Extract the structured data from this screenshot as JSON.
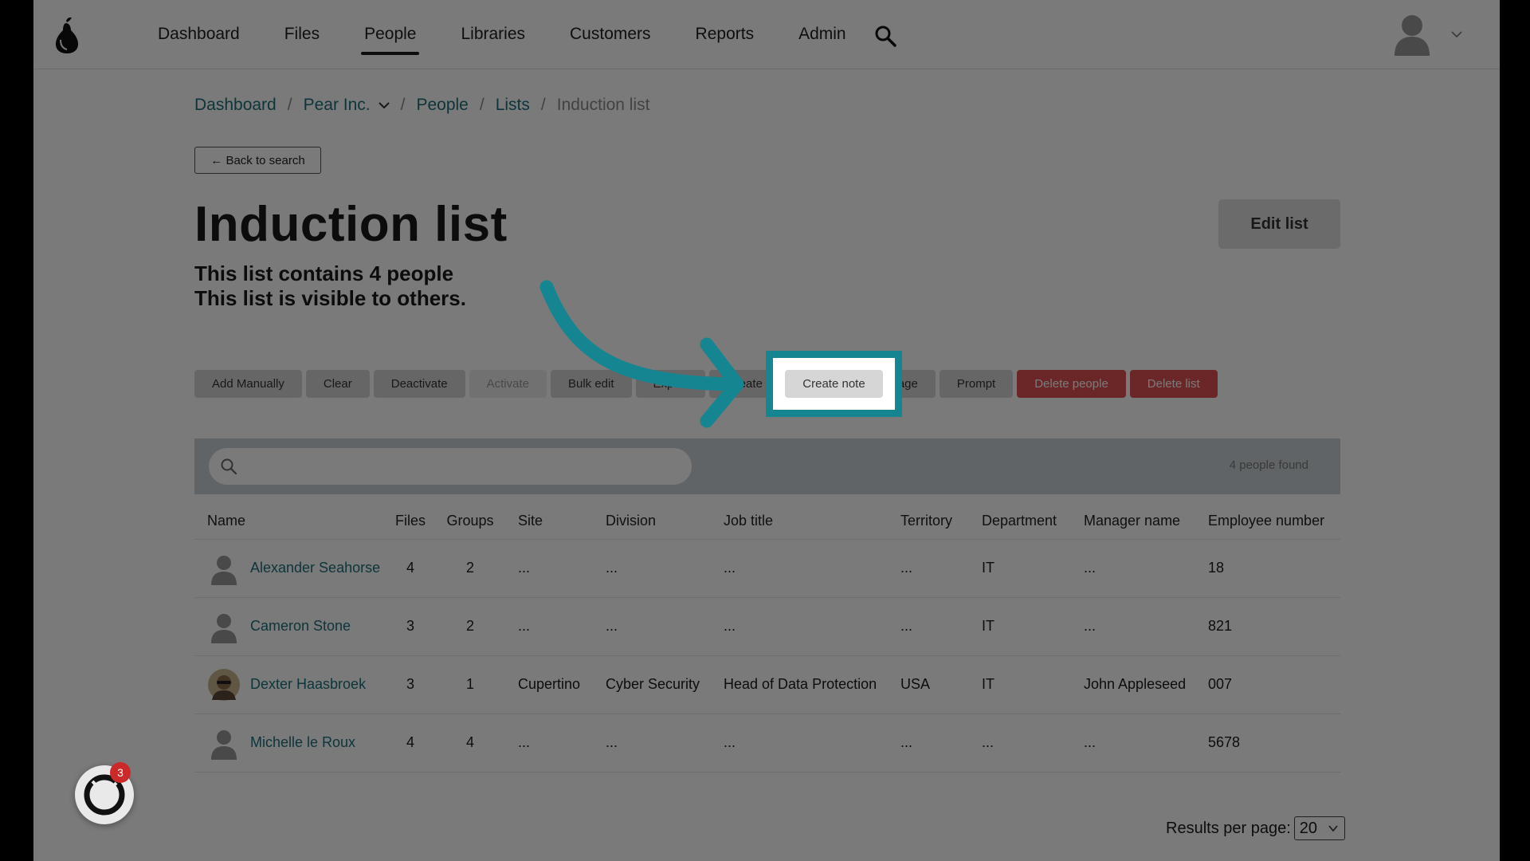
{
  "nav": {
    "items": [
      {
        "label": "Dashboard"
      },
      {
        "label": "Files"
      },
      {
        "label": "People",
        "active": true
      },
      {
        "label": "Libraries"
      },
      {
        "label": "Customers"
      },
      {
        "label": "Reports"
      },
      {
        "label": "Admin"
      }
    ],
    "search_icon": "search-icon",
    "avatar_icon": "user-avatar-icon"
  },
  "breadcrumb": {
    "items": [
      "Dashboard",
      "Pear Inc.",
      "People",
      "Lists",
      "Induction list"
    ],
    "separator": "/"
  },
  "back_button": "← Back to search",
  "page": {
    "title": "Induction list",
    "edit_label": "Edit list",
    "summary_line1": "This list contains 4 people",
    "summary_line2": "This list is visible to others."
  },
  "actions": {
    "add_manually": "Add Manually",
    "clear": "Clear",
    "deactivate": "Deactivate",
    "activate": "Activate",
    "bulk_edit": "Bulk edit",
    "export": "Export",
    "create_note": "Create note",
    "send_message": "Send a message",
    "prompt": "Prompt",
    "delete_people": "Delete people",
    "delete_list": "Delete list"
  },
  "search": {
    "placeholder": "",
    "found_text": "4 people found"
  },
  "table": {
    "headers": [
      "Name",
      "Files",
      "Groups",
      "Site",
      "Division",
      "Job title",
      "Territory",
      "Department",
      "Manager name",
      "Employee number"
    ],
    "rows": [
      {
        "name": "Alexander Seahorse",
        "files": "4",
        "groups": "2",
        "site": "...",
        "division": "...",
        "job_title": "...",
        "territory": "...",
        "department": "IT",
        "manager": "...",
        "employee_number": "18"
      },
      {
        "name": "Cameron Stone",
        "files": "3",
        "groups": "2",
        "site": "...",
        "division": "...",
        "job_title": "...",
        "territory": "...",
        "department": "IT",
        "manager": "...",
        "employee_number": "821"
      },
      {
        "name": "Dexter Haasbroek",
        "files": "3",
        "groups": "1",
        "site": "Cupertino",
        "division": "Cyber Security",
        "job_title": "Head of Data Protection",
        "territory": "USA",
        "department": "IT",
        "manager": "John Appleseed",
        "employee_number": "007"
      },
      {
        "name": "Michelle le Roux",
        "files": "4",
        "groups": "4",
        "site": "...",
        "division": "...",
        "job_title": "...",
        "territory": "...",
        "department": "...",
        "manager": "...",
        "employee_number": "5678"
      }
    ]
  },
  "pagination": {
    "label": "Results per page:",
    "value": "20"
  },
  "widget": {
    "badge": "3"
  },
  "colors": {
    "accent": "#168592",
    "link": "#1f6f7b",
    "danger": "#e05252"
  }
}
